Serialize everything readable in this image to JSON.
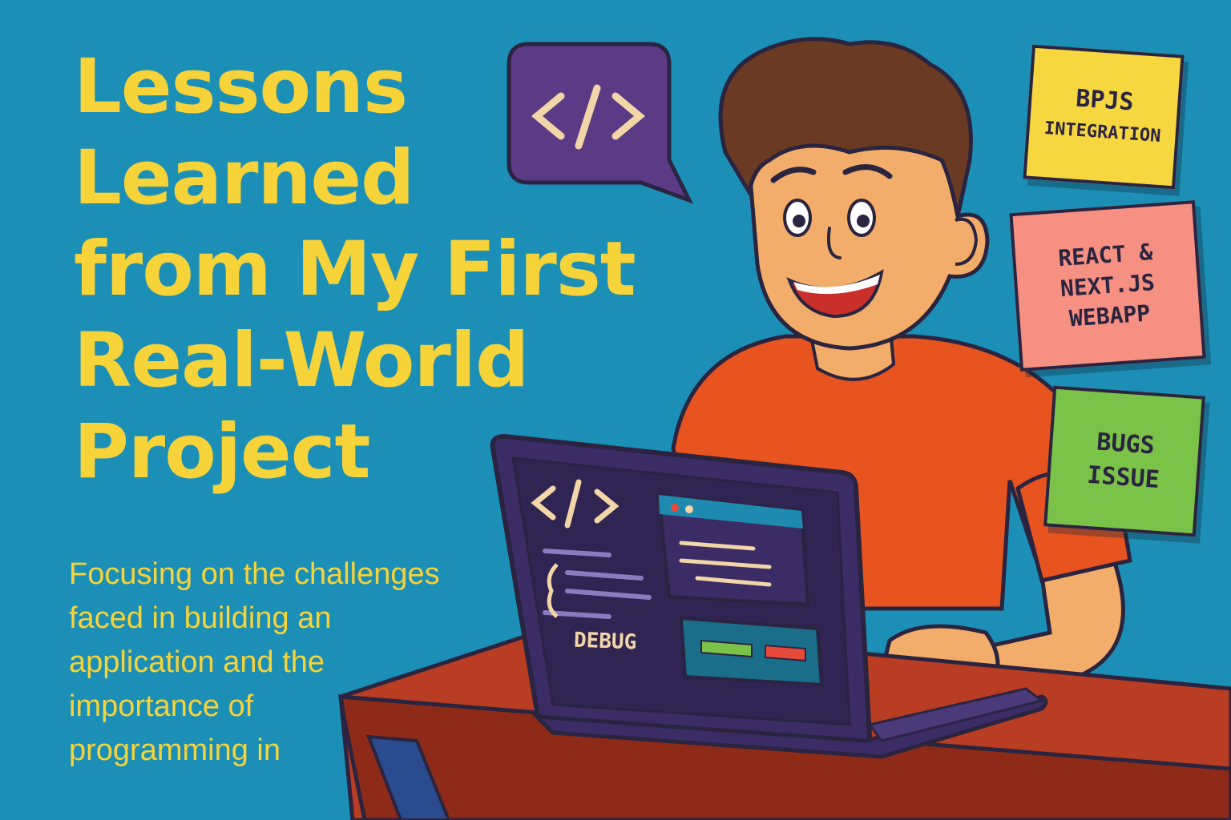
{
  "title_lines": [
    "Lessons",
    "Learned",
    "from My First",
    "Real-World",
    "Project"
  ],
  "subtitle_lines": [
    "Focusing on the challenges",
    "faced in building an",
    "application and the",
    "importance of",
    "programming in"
  ],
  "notes": {
    "bpjs": [
      "BPJS",
      "INTEGRATION"
    ],
    "react": [
      "REACT &",
      "NEXT.JS",
      "WEBAPP"
    ],
    "bugs": [
      "BUGS",
      "ISSUE"
    ]
  },
  "laptop_screen": {
    "debug_label": "DEBUG"
  },
  "icons": {
    "speech_bubble": "code-brackets-icon",
    "screen_code": "code-brackets-icon"
  },
  "colors": {
    "background": "#1b8fb5",
    "title": "#f7d33a",
    "shirt": "#e8541f",
    "desk": "#b83d22",
    "laptop": "#3b2c66",
    "speech_bubble": "#5b3a86",
    "note_yellow": "#f6d740",
    "note_salmon": "#f59082",
    "note_green": "#7bc249"
  }
}
